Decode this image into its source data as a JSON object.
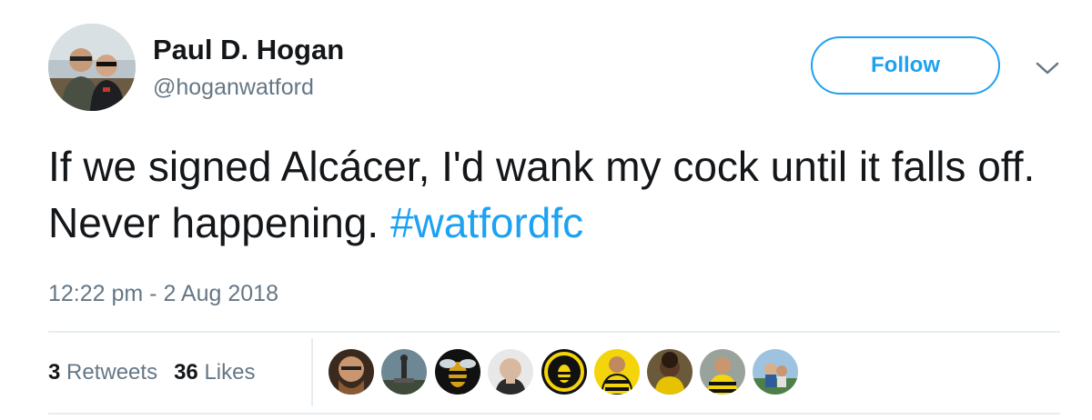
{
  "author": {
    "display_name": "Paul D. Hogan",
    "handle": "@hoganwatford",
    "avatar_icon": "profile-photo-avatar"
  },
  "header": {
    "follow_label": "Follow",
    "menu_icon": "chevron-down-icon"
  },
  "tweet": {
    "text_part1": "If we signed Alcácer, I'd wank my cock until it falls off. Never happening. ",
    "hashtag": "#watfordfc",
    "timestamp": "12:22 pm - 2 Aug 2018"
  },
  "stats": {
    "retweets_count": "3",
    "retweets_label": "Retweets",
    "likes_count": "36",
    "likes_label": "Likes"
  },
  "likers": [
    "liker-avatar-1",
    "liker-avatar-2",
    "liker-avatar-3",
    "liker-avatar-4",
    "liker-avatar-5",
    "liker-avatar-6",
    "liker-avatar-7",
    "liker-avatar-8",
    "liker-avatar-9"
  ],
  "colors": {
    "accent": "#1da1f2",
    "text_primary": "#14171a",
    "text_secondary": "#657786",
    "divider": "#e6ecf0"
  }
}
